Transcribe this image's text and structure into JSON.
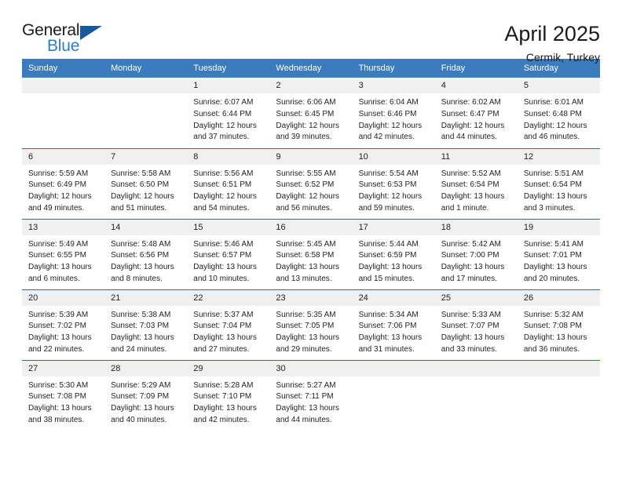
{
  "brand": {
    "name_part1": "General",
    "name_part2": "Blue",
    "triangle_color": "#17599c",
    "blue_color": "#2c7fc4"
  },
  "header": {
    "title": "April 2025",
    "location": "Cermik, Turkey",
    "accent_color": "#3c7cbe",
    "separator_color": "#2c6ca8",
    "daynum_band_color": "#f0f0f0"
  },
  "weekdays": [
    "Sunday",
    "Monday",
    "Tuesday",
    "Wednesday",
    "Thursday",
    "Friday",
    "Saturday"
  ],
  "weeks": [
    [
      {
        "day": "",
        "sunrise": "",
        "sunset": "",
        "daylight1": "",
        "daylight2": ""
      },
      {
        "day": "",
        "sunrise": "",
        "sunset": "",
        "daylight1": "",
        "daylight2": ""
      },
      {
        "day": "1",
        "sunrise": "Sunrise: 6:07 AM",
        "sunset": "Sunset: 6:44 PM",
        "daylight1": "Daylight: 12 hours",
        "daylight2": "and 37 minutes."
      },
      {
        "day": "2",
        "sunrise": "Sunrise: 6:06 AM",
        "sunset": "Sunset: 6:45 PM",
        "daylight1": "Daylight: 12 hours",
        "daylight2": "and 39 minutes."
      },
      {
        "day": "3",
        "sunrise": "Sunrise: 6:04 AM",
        "sunset": "Sunset: 6:46 PM",
        "daylight1": "Daylight: 12 hours",
        "daylight2": "and 42 minutes."
      },
      {
        "day": "4",
        "sunrise": "Sunrise: 6:02 AM",
        "sunset": "Sunset: 6:47 PM",
        "daylight1": "Daylight: 12 hours",
        "daylight2": "and 44 minutes."
      },
      {
        "day": "5",
        "sunrise": "Sunrise: 6:01 AM",
        "sunset": "Sunset: 6:48 PM",
        "daylight1": "Daylight: 12 hours",
        "daylight2": "and 46 minutes."
      }
    ],
    [
      {
        "day": "6",
        "sunrise": "Sunrise: 5:59 AM",
        "sunset": "Sunset: 6:49 PM",
        "daylight1": "Daylight: 12 hours",
        "daylight2": "and 49 minutes."
      },
      {
        "day": "7",
        "sunrise": "Sunrise: 5:58 AM",
        "sunset": "Sunset: 6:50 PM",
        "daylight1": "Daylight: 12 hours",
        "daylight2": "and 51 minutes."
      },
      {
        "day": "8",
        "sunrise": "Sunrise: 5:56 AM",
        "sunset": "Sunset: 6:51 PM",
        "daylight1": "Daylight: 12 hours",
        "daylight2": "and 54 minutes."
      },
      {
        "day": "9",
        "sunrise": "Sunrise: 5:55 AM",
        "sunset": "Sunset: 6:52 PM",
        "daylight1": "Daylight: 12 hours",
        "daylight2": "and 56 minutes."
      },
      {
        "day": "10",
        "sunrise": "Sunrise: 5:54 AM",
        "sunset": "Sunset: 6:53 PM",
        "daylight1": "Daylight: 12 hours",
        "daylight2": "and 59 minutes."
      },
      {
        "day": "11",
        "sunrise": "Sunrise: 5:52 AM",
        "sunset": "Sunset: 6:54 PM",
        "daylight1": "Daylight: 13 hours",
        "daylight2": "and 1 minute."
      },
      {
        "day": "12",
        "sunrise": "Sunrise: 5:51 AM",
        "sunset": "Sunset: 6:54 PM",
        "daylight1": "Daylight: 13 hours",
        "daylight2": "and 3 minutes."
      }
    ],
    [
      {
        "day": "13",
        "sunrise": "Sunrise: 5:49 AM",
        "sunset": "Sunset: 6:55 PM",
        "daylight1": "Daylight: 13 hours",
        "daylight2": "and 6 minutes."
      },
      {
        "day": "14",
        "sunrise": "Sunrise: 5:48 AM",
        "sunset": "Sunset: 6:56 PM",
        "daylight1": "Daylight: 13 hours",
        "daylight2": "and 8 minutes."
      },
      {
        "day": "15",
        "sunrise": "Sunrise: 5:46 AM",
        "sunset": "Sunset: 6:57 PM",
        "daylight1": "Daylight: 13 hours",
        "daylight2": "and 10 minutes."
      },
      {
        "day": "16",
        "sunrise": "Sunrise: 5:45 AM",
        "sunset": "Sunset: 6:58 PM",
        "daylight1": "Daylight: 13 hours",
        "daylight2": "and 13 minutes."
      },
      {
        "day": "17",
        "sunrise": "Sunrise: 5:44 AM",
        "sunset": "Sunset: 6:59 PM",
        "daylight1": "Daylight: 13 hours",
        "daylight2": "and 15 minutes."
      },
      {
        "day": "18",
        "sunrise": "Sunrise: 5:42 AM",
        "sunset": "Sunset: 7:00 PM",
        "daylight1": "Daylight: 13 hours",
        "daylight2": "and 17 minutes."
      },
      {
        "day": "19",
        "sunrise": "Sunrise: 5:41 AM",
        "sunset": "Sunset: 7:01 PM",
        "daylight1": "Daylight: 13 hours",
        "daylight2": "and 20 minutes."
      }
    ],
    [
      {
        "day": "20",
        "sunrise": "Sunrise: 5:39 AM",
        "sunset": "Sunset: 7:02 PM",
        "daylight1": "Daylight: 13 hours",
        "daylight2": "and 22 minutes."
      },
      {
        "day": "21",
        "sunrise": "Sunrise: 5:38 AM",
        "sunset": "Sunset: 7:03 PM",
        "daylight1": "Daylight: 13 hours",
        "daylight2": "and 24 minutes."
      },
      {
        "day": "22",
        "sunrise": "Sunrise: 5:37 AM",
        "sunset": "Sunset: 7:04 PM",
        "daylight1": "Daylight: 13 hours",
        "daylight2": "and 27 minutes."
      },
      {
        "day": "23",
        "sunrise": "Sunrise: 5:35 AM",
        "sunset": "Sunset: 7:05 PM",
        "daylight1": "Daylight: 13 hours",
        "daylight2": "and 29 minutes."
      },
      {
        "day": "24",
        "sunrise": "Sunrise: 5:34 AM",
        "sunset": "Sunset: 7:06 PM",
        "daylight1": "Daylight: 13 hours",
        "daylight2": "and 31 minutes."
      },
      {
        "day": "25",
        "sunrise": "Sunrise: 5:33 AM",
        "sunset": "Sunset: 7:07 PM",
        "daylight1": "Daylight: 13 hours",
        "daylight2": "and 33 minutes."
      },
      {
        "day": "26",
        "sunrise": "Sunrise: 5:32 AM",
        "sunset": "Sunset: 7:08 PM",
        "daylight1": "Daylight: 13 hours",
        "daylight2": "and 36 minutes."
      }
    ],
    [
      {
        "day": "27",
        "sunrise": "Sunrise: 5:30 AM",
        "sunset": "Sunset: 7:08 PM",
        "daylight1": "Daylight: 13 hours",
        "daylight2": "and 38 minutes."
      },
      {
        "day": "28",
        "sunrise": "Sunrise: 5:29 AM",
        "sunset": "Sunset: 7:09 PM",
        "daylight1": "Daylight: 13 hours",
        "daylight2": "and 40 minutes."
      },
      {
        "day": "29",
        "sunrise": "Sunrise: 5:28 AM",
        "sunset": "Sunset: 7:10 PM",
        "daylight1": "Daylight: 13 hours",
        "daylight2": "and 42 minutes."
      },
      {
        "day": "30",
        "sunrise": "Sunrise: 5:27 AM",
        "sunset": "Sunset: 7:11 PM",
        "daylight1": "Daylight: 13 hours",
        "daylight2": "and 44 minutes."
      },
      {
        "day": "",
        "sunrise": "",
        "sunset": "",
        "daylight1": "",
        "daylight2": ""
      },
      {
        "day": "",
        "sunrise": "",
        "sunset": "",
        "daylight1": "",
        "daylight2": ""
      },
      {
        "day": "",
        "sunrise": "",
        "sunset": "",
        "daylight1": "",
        "daylight2": ""
      }
    ]
  ]
}
